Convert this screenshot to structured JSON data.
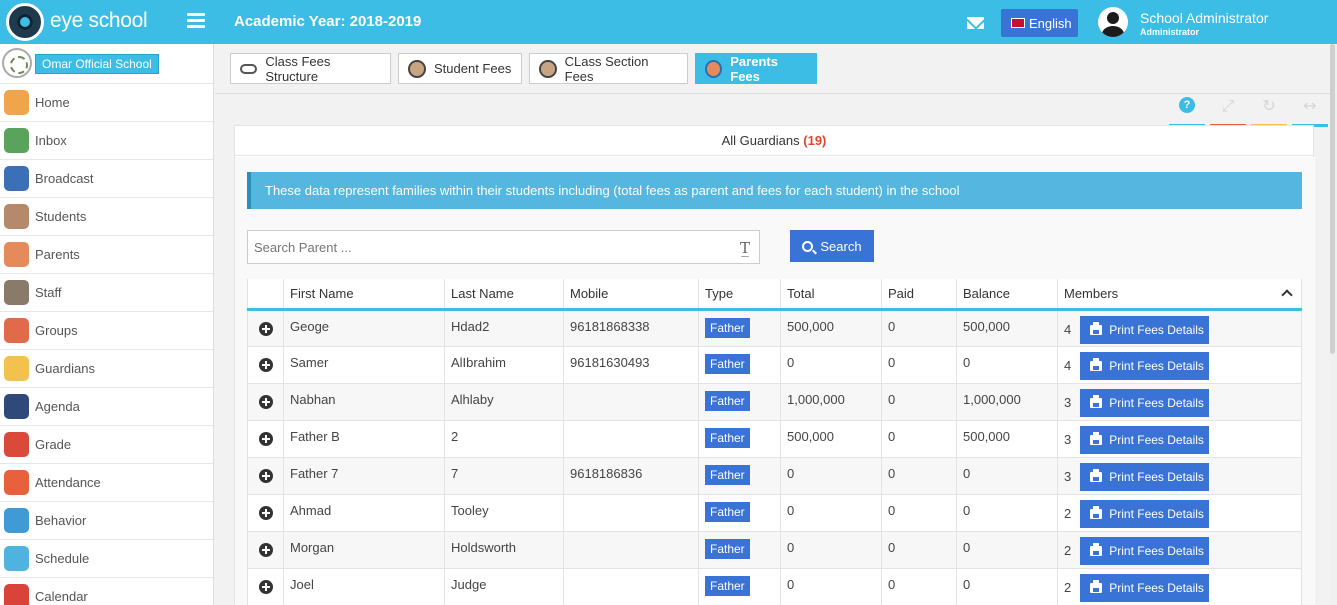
{
  "app": {
    "brand": "eye school",
    "academic_year": "Academic Year: 2018-2019",
    "language": "English",
    "user_name": "School Administrator",
    "user_role": "Administrator",
    "accent_color": "#3cbde6",
    "button_color": "#3a73d6"
  },
  "sidebar": {
    "school_name": "Omar Official School",
    "items": [
      {
        "label": "Home",
        "icon": "home-icon",
        "color": "#f0a44b"
      },
      {
        "label": "Inbox",
        "icon": "inbox-icon",
        "color": "#5aa35c"
      },
      {
        "label": "Broadcast",
        "icon": "broadcast-icon",
        "color": "#3b6fb6"
      },
      {
        "label": "Students",
        "icon": "students-icon",
        "color": "#b48a6a"
      },
      {
        "label": "Parents",
        "icon": "parents-icon",
        "color": "#e58a5a"
      },
      {
        "label": "Staff",
        "icon": "staff-icon",
        "color": "#8a7a6a"
      },
      {
        "label": "Groups",
        "icon": "groups-icon",
        "color": "#e06a4a"
      },
      {
        "label": "Guardians",
        "icon": "guardians-icon",
        "color": "#f2c14e"
      },
      {
        "label": "Agenda",
        "icon": "agenda-icon",
        "color": "#2f4a7a"
      },
      {
        "label": "Grade",
        "icon": "grade-icon",
        "color": "#d94a3a"
      },
      {
        "label": "Attendance",
        "icon": "attendance-icon",
        "color": "#e8613d"
      },
      {
        "label": "Behavior",
        "icon": "behavior-icon",
        "color": "#3f9ad6"
      },
      {
        "label": "Schedule",
        "icon": "schedule-icon",
        "color": "#4fb3e0"
      },
      {
        "label": "Calendar",
        "icon": "calendar-icon",
        "color": "#d9433a"
      }
    ]
  },
  "tabs": [
    {
      "label": "Class Fees Structure",
      "icon": "class-fees-icon",
      "active": false
    },
    {
      "label": "Student Fees",
      "icon": "student-fees-icon",
      "active": false
    },
    {
      "label": "CLass Section Fees",
      "icon": "section-fees-icon",
      "active": false
    },
    {
      "label": "Parents Fees",
      "icon": "parents-fees-icon",
      "active": true
    }
  ],
  "panel": {
    "title": "All Guardians",
    "count": "(19)",
    "info": "These data represent families within their students including (total fees as parent and fees for each student) in the school",
    "search_placeholder": "Search Parent ...",
    "search_label": "Search"
  },
  "table": {
    "columns": [
      "First Name",
      "Last Name",
      "Mobile",
      "Type",
      "Total",
      "Paid",
      "Balance",
      "Members"
    ],
    "print_label": "Print Fees Details",
    "rows": [
      {
        "first": "Geoge",
        "last": "Hdad2",
        "mobile": "96181868338",
        "type": "Father",
        "total": "500,000",
        "paid": "0",
        "balance": "500,000",
        "members": "4"
      },
      {
        "first": "Samer",
        "last": "AlIbrahim",
        "mobile": "96181630493",
        "type": "Father",
        "total": "0",
        "paid": "0",
        "balance": "0",
        "members": "4"
      },
      {
        "first": "Nabhan",
        "last": "Alhlaby",
        "mobile": "",
        "type": "Father",
        "total": "1,000,000",
        "paid": "0",
        "balance": "1,000,000",
        "members": "3"
      },
      {
        "first": "Father B",
        "last": "2",
        "mobile": "",
        "type": "Father",
        "total": "500,000",
        "paid": "0",
        "balance": "500,000",
        "members": "3"
      },
      {
        "first": "Father 7",
        "last": "7",
        "mobile": "9618186836",
        "type": "Father",
        "total": "0",
        "paid": "0",
        "balance": "0",
        "members": "3"
      },
      {
        "first": "Ahmad",
        "last": "Tooley",
        "mobile": "",
        "type": "Father",
        "total": "0",
        "paid": "0",
        "balance": "0",
        "members": "2"
      },
      {
        "first": "Morgan",
        "last": "Holdsworth",
        "mobile": "",
        "type": "Father",
        "total": "0",
        "paid": "0",
        "balance": "0",
        "members": "2"
      },
      {
        "first": "Joel",
        "last": "Judge",
        "mobile": "",
        "type": "Father",
        "total": "0",
        "paid": "0",
        "balance": "0",
        "members": "2"
      }
    ]
  },
  "tools": [
    {
      "icon": "help-icon",
      "color": "#3cbde6"
    },
    {
      "icon": "fullscreen-icon",
      "color": "#e2603f"
    },
    {
      "icon": "refresh-icon",
      "color": "#f2c14e"
    },
    {
      "icon": "collapse-icon",
      "color": "#3cbde6"
    }
  ]
}
